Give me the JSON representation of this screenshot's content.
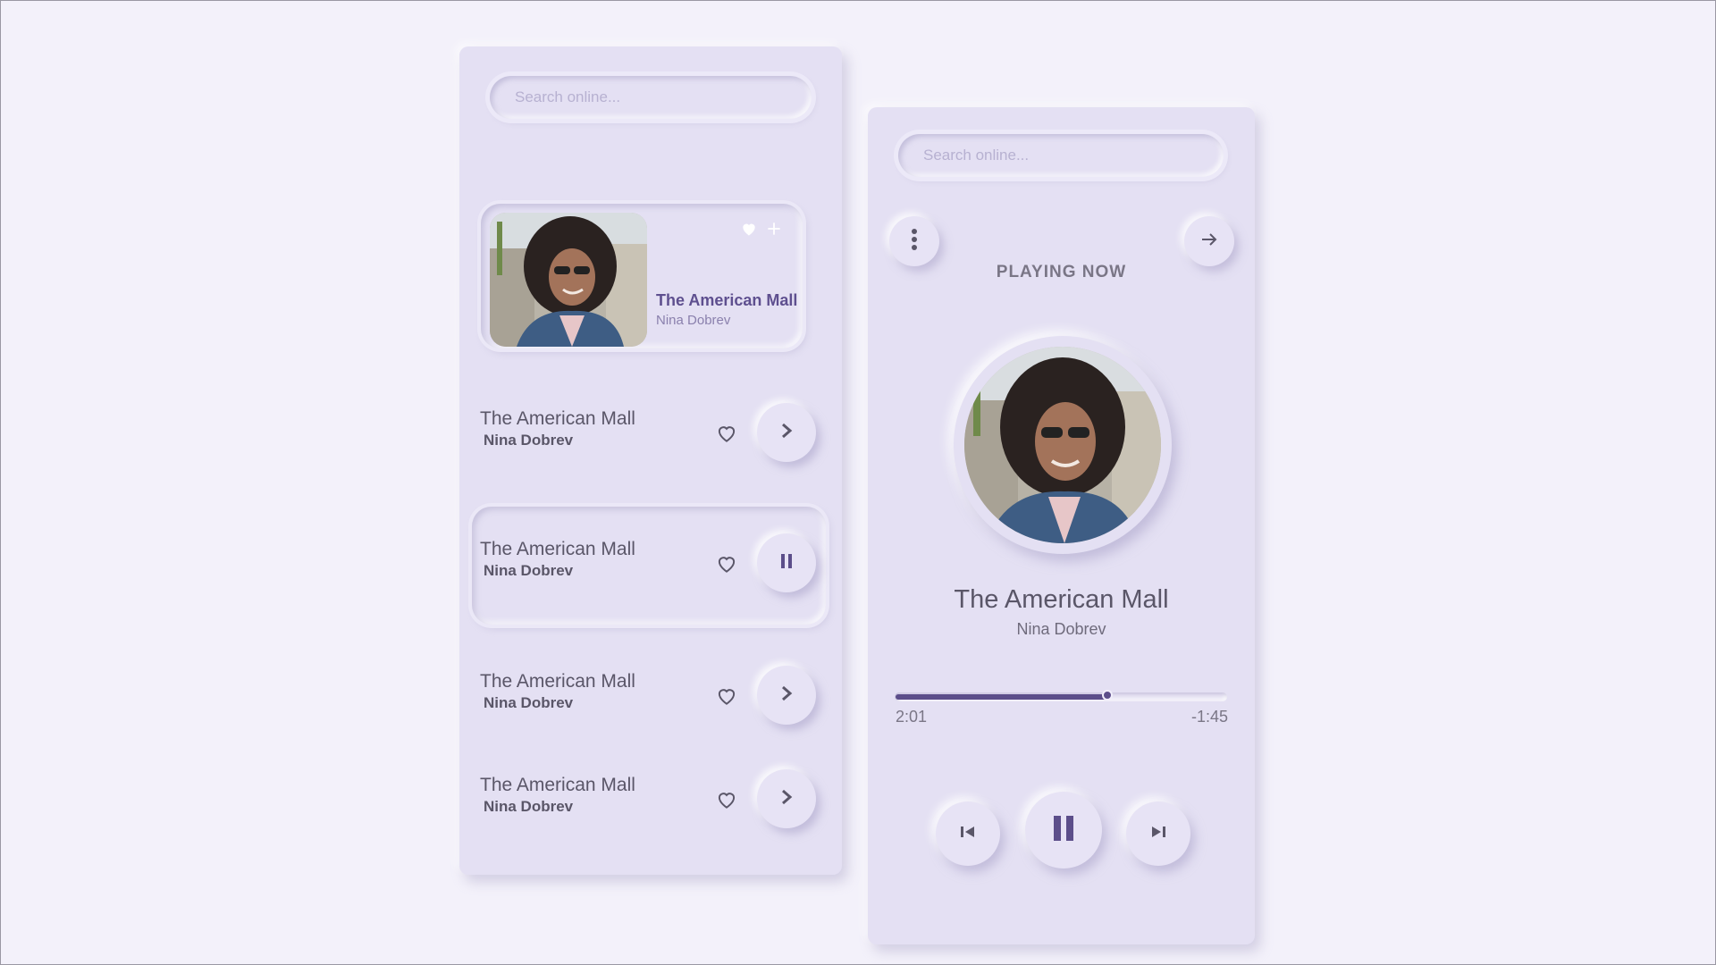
{
  "search": {
    "placeholder": "Search online..."
  },
  "featured": {
    "title": "The American Mall",
    "artist": "Nina Dobrev",
    "icons": [
      "heart-icon",
      "plus-icon"
    ]
  },
  "playlist": [
    {
      "title": "The American Mall",
      "artist": "Nina Dobrev",
      "state": "play"
    },
    {
      "title": "The American Mall",
      "artist": "Nina Dobrev",
      "state": "pause"
    },
    {
      "title": "The American Mall",
      "artist": "Nina Dobrev",
      "state": "play"
    },
    {
      "title": "The American Mall",
      "artist": "Nina Dobrev",
      "state": "play"
    }
  ],
  "player": {
    "search_placeholder": "Search online...",
    "header": "PLAYING NOW",
    "title": "The American Mall",
    "artist": "Nina Dobrev",
    "elapsed": "2:01",
    "remaining": "-1:45",
    "progress": 0.64
  },
  "colors": {
    "accent": "#5c4e8a",
    "panel": "#e4e0f3",
    "background": "#f3f1fa"
  }
}
